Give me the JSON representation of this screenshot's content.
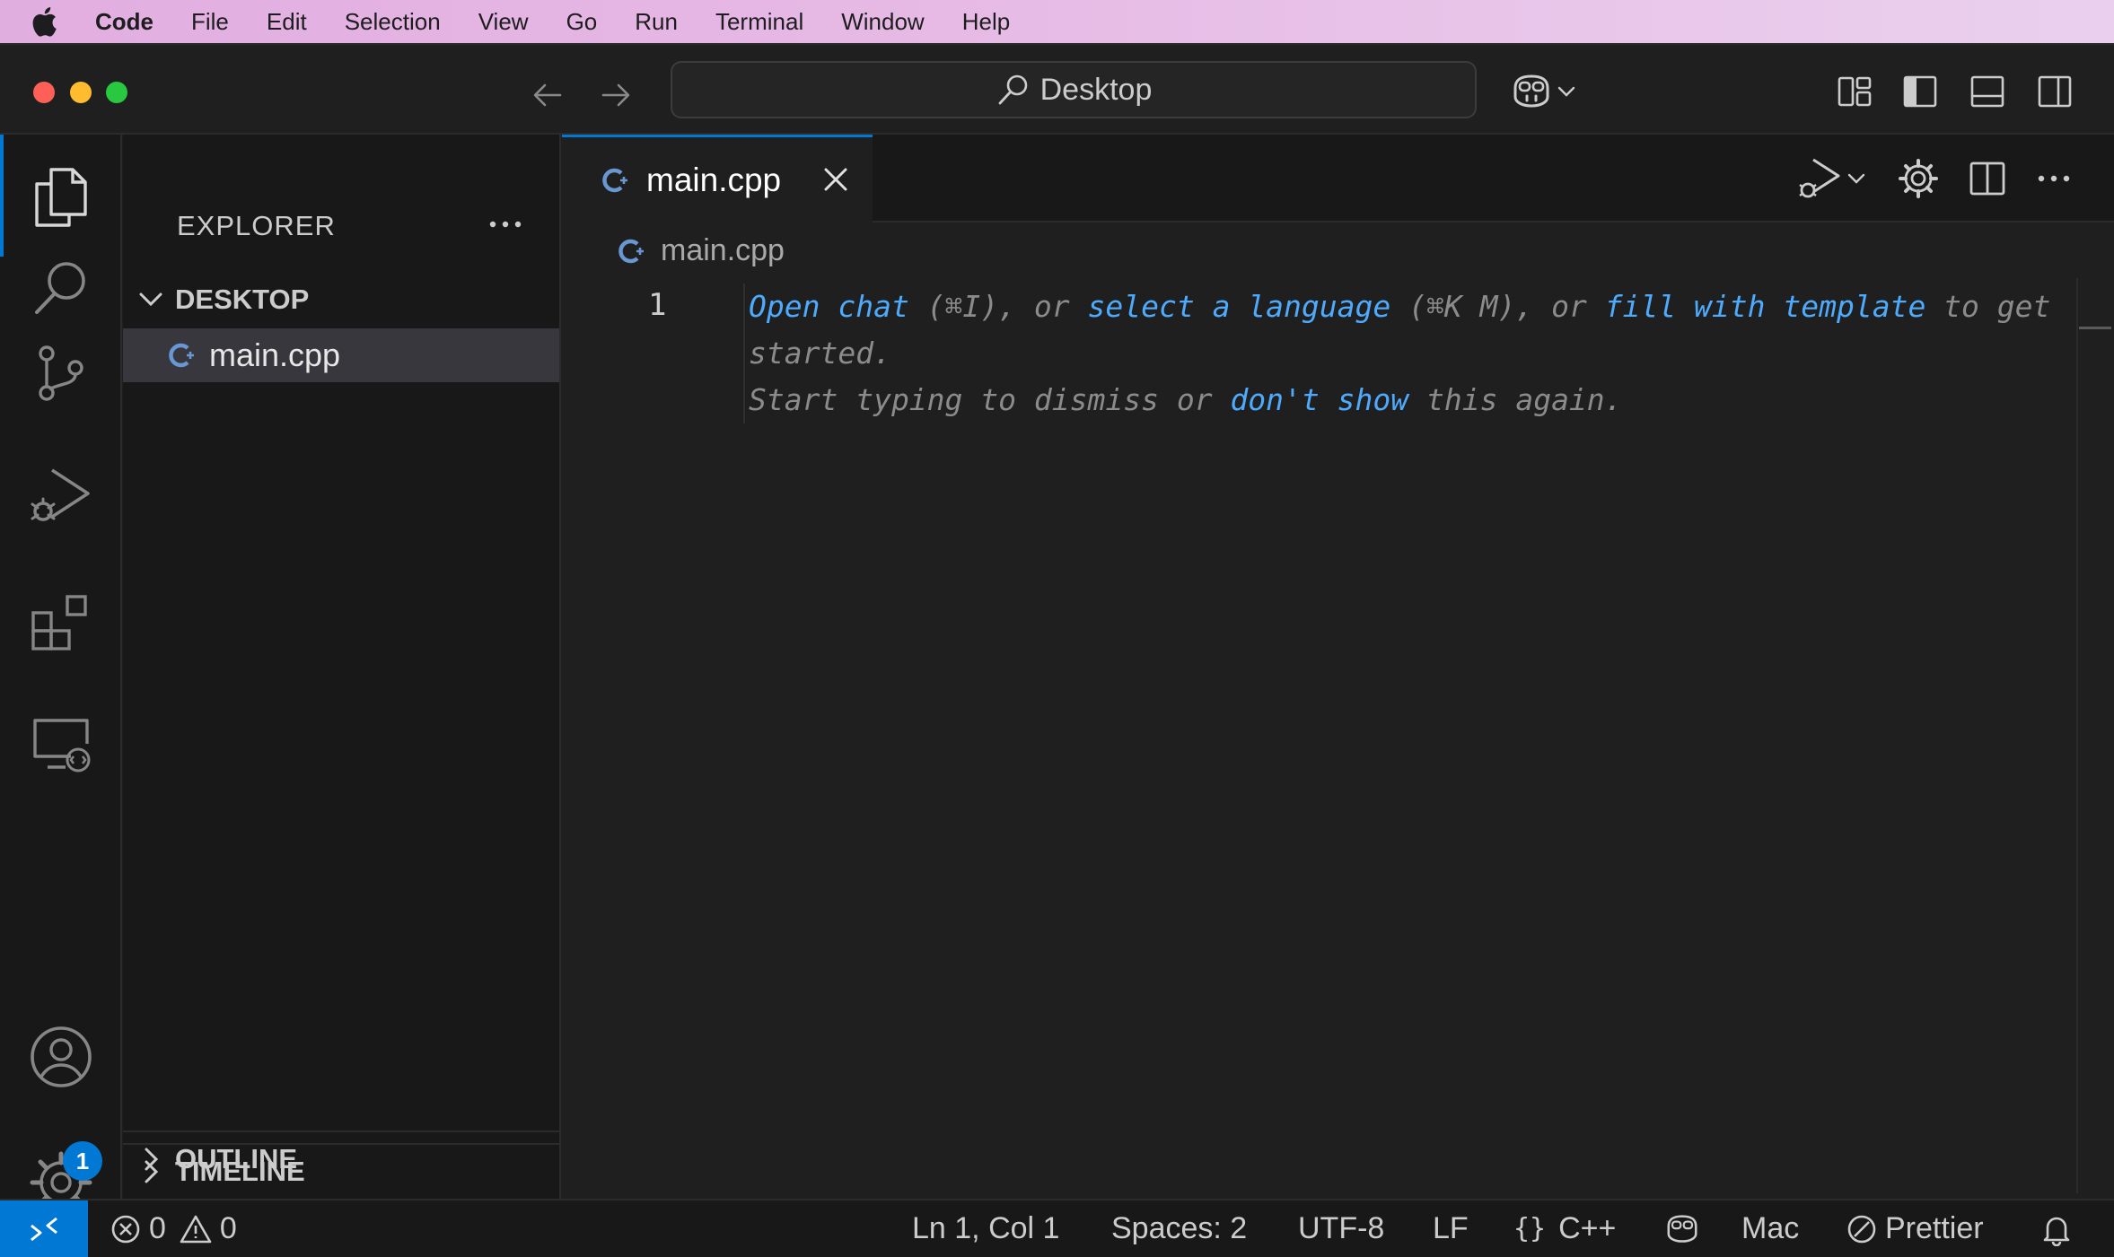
{
  "menubar": {
    "items": [
      "Code",
      "File",
      "Edit",
      "Selection",
      "View",
      "Go",
      "Run",
      "Terminal",
      "Window",
      "Help"
    ]
  },
  "titlebar": {
    "search_text": "Desktop"
  },
  "sidebar": {
    "title": "EXPLORER",
    "folder": "DESKTOP",
    "files": [
      "main.cpp"
    ],
    "sections": [
      "OUTLINE",
      "TIMELINE"
    ]
  },
  "editor": {
    "tab_label": "main.cpp",
    "breadcrumb": "main.cpp",
    "line_number": "1",
    "hint": {
      "open_chat": "Open chat",
      "open_chat_key": " (⌘I), or ",
      "select_language": "select a language",
      "select_language_key": " (⌘K M), or ",
      "fill_template": "fill with template",
      "to_get": " to get",
      "started": "started.",
      "start_typing": "Start typing to dismiss or ",
      "dont_show": "don't show",
      "this_again": " this again."
    }
  },
  "activitybar": {
    "settings_badge": "1"
  },
  "statusbar": {
    "errors": "0",
    "warnings": "0",
    "cursor": "Ln 1, Col 1",
    "spaces": "Spaces: 2",
    "encoding": "UTF-8",
    "eol": "LF",
    "language": "C++",
    "keymap": "Mac",
    "formatter": "Prettier"
  },
  "colors": {
    "accent": "#0078d4",
    "link": "#4daafc",
    "background": "#1f1f1f"
  }
}
